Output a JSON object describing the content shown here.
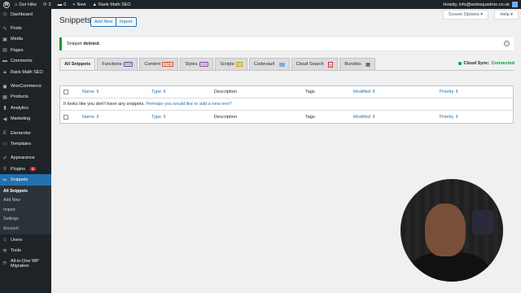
{
  "adminbar": {
    "site_name": "Our Hike",
    "updates": "2",
    "comments": "0",
    "new_label": "New",
    "seo_label": "Rank Math SEO",
    "howdy": "Howdy, info@websquadron.co.uk"
  },
  "sidebar": {
    "items": [
      {
        "label": "Dashboard",
        "icon": "dashboard-icon",
        "glyph": "◷"
      },
      {
        "label": "Posts",
        "icon": "pin-icon",
        "glyph": "✎"
      },
      {
        "label": "Media",
        "icon": "media-icon",
        "glyph": "▣"
      },
      {
        "label": "Pages",
        "icon": "page-icon",
        "glyph": "▤"
      },
      {
        "label": "Comments",
        "icon": "comment-icon",
        "glyph": "▬"
      },
      {
        "label": "Rank Math SEO",
        "icon": "chart-icon",
        "glyph": "▲"
      },
      {
        "label": "WooCommerce",
        "icon": "woo-icon",
        "glyph": "◼"
      },
      {
        "label": "Products",
        "icon": "products-icon",
        "glyph": "▦"
      },
      {
        "label": "Analytics",
        "icon": "analytics-icon",
        "glyph": "▮"
      },
      {
        "label": "Marketing",
        "icon": "megaphone-icon",
        "glyph": "◀"
      },
      {
        "label": "Elementor",
        "icon": "elementor-icon",
        "glyph": "E"
      },
      {
        "label": "Templates",
        "icon": "folder-icon",
        "glyph": "▭"
      },
      {
        "label": "Appearance",
        "icon": "brush-icon",
        "glyph": "✐"
      },
      {
        "label": "Plugins",
        "icon": "plugin-icon",
        "glyph": "⚲",
        "badge": "1"
      },
      {
        "label": "Snippets",
        "icon": "scissors-icon",
        "glyph": "✂"
      },
      {
        "label": "Users",
        "icon": "users-icon",
        "glyph": "☺"
      },
      {
        "label": "Tools",
        "icon": "wrench-icon",
        "glyph": "⚒"
      },
      {
        "label": "All-in-One WP Migration",
        "icon": "migration-icon",
        "glyph": "⟳"
      }
    ],
    "submenu": [
      "All Snippets",
      "Add New",
      "Import",
      "Settings",
      "Account"
    ]
  },
  "header": {
    "title": "Snippets",
    "add_new": "Add New",
    "import": "Import",
    "screen_options": "Screen Options ▾",
    "help": "Help ▾"
  },
  "notice": {
    "text_a": "Snippet",
    "text_b": "deleted."
  },
  "tabs": [
    {
      "label": "All Snippets",
      "tag": ""
    },
    {
      "label": "Functions",
      "tag": "PHP"
    },
    {
      "label": "Content",
      "tag": "HTML"
    },
    {
      "label": "Styles",
      "tag": "CSS"
    },
    {
      "label": "Scripts",
      "tag": "JS"
    },
    {
      "label": "Codevault",
      "tag": ""
    },
    {
      "label": "Cloud Search",
      "tag": ""
    },
    {
      "label": "Bundles",
      "tag": ""
    }
  ],
  "sync": {
    "label": "Cloud Sync:",
    "status": "Connected"
  },
  "table": {
    "columns": [
      "Name",
      "Type",
      "Description",
      "Tags",
      "Modified",
      "Priority"
    ],
    "empty_text": "It looks like you don't have any snippets.",
    "empty_link": "Perhaps you would like to add a new one?"
  },
  "colors": {
    "accent": "#2271b1",
    "sidebar_bg": "#1d2327",
    "success": "#00a32a"
  }
}
